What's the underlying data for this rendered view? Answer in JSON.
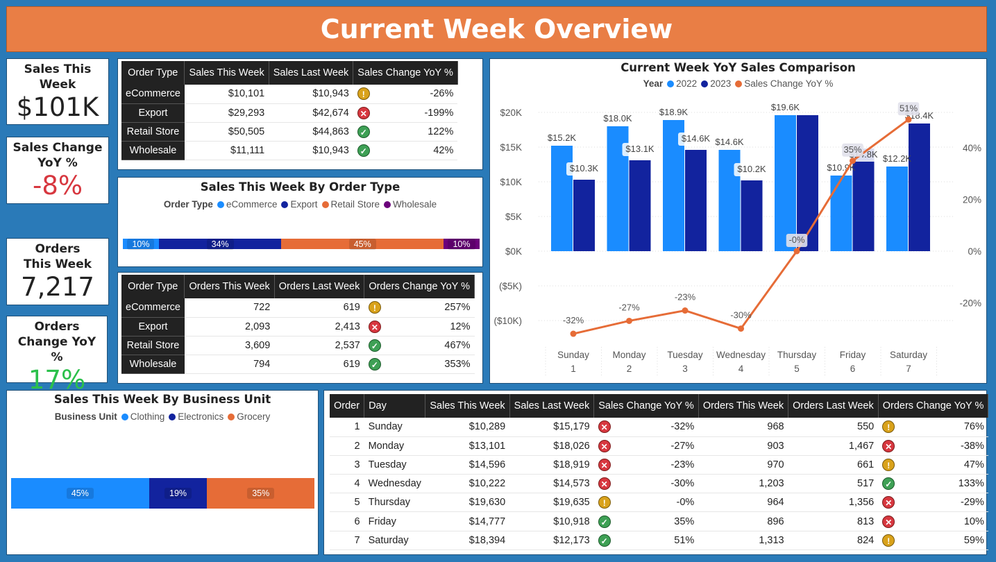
{
  "header": {
    "title": "Current Week Overview"
  },
  "kpis": {
    "sales": {
      "title": "Sales This Week",
      "value": "$101K"
    },
    "sales_change": {
      "title": "Sales Change YoY %",
      "value": "-8%",
      "color": "#d7373f"
    },
    "orders": {
      "title": "Orders This Week",
      "value": "7,217"
    },
    "orders_change": {
      "title": "Orders Change YoY %",
      "value": "17%",
      "color": "#2bc04b"
    }
  },
  "sales_table": {
    "headers": [
      "Order Type",
      "Sales This Week",
      "Sales Last Week",
      "Sales Change YoY %"
    ],
    "rows": [
      {
        "type": "eCommerce",
        "this": "$10,101",
        "last": "$10,943",
        "icon": "warn",
        "change": "-26%"
      },
      {
        "type": "Export",
        "this": "$29,293",
        "last": "$42,674",
        "icon": "bad",
        "change": "-199%"
      },
      {
        "type": "Retail Store",
        "this": "$50,505",
        "last": "$44,863",
        "icon": "good",
        "change": "122%"
      },
      {
        "type": "Wholesale",
        "this": "$11,111",
        "last": "$10,943",
        "icon": "good",
        "change": "42%"
      }
    ]
  },
  "orders_table": {
    "headers": [
      "Order Type",
      "Orders This Week",
      "Orders Last Week",
      "Orders Change YoY %"
    ],
    "rows": [
      {
        "type": "eCommerce",
        "this": "722",
        "last": "619",
        "icon": "warn",
        "change": "257%"
      },
      {
        "type": "Export",
        "this": "2,093",
        "last": "2,413",
        "icon": "bad",
        "change": "12%"
      },
      {
        "type": "Retail Store",
        "this": "3,609",
        "last": "2,537",
        "icon": "good",
        "change": "467%"
      },
      {
        "type": "Wholesale",
        "this": "794",
        "last": "619",
        "icon": "good",
        "change": "353%"
      }
    ]
  },
  "day_table": {
    "headers": [
      "Order",
      "Day",
      "Sales This Week",
      "Sales Last Week",
      "Sales Change YoY %",
      "Orders This Week",
      "Orders Last Week",
      "Orders Change YoY %"
    ],
    "rows": [
      {
        "order": "1",
        "day": "Sunday",
        "st": "$10,289",
        "sl": "$15,179",
        "si": "bad",
        "sc": "-32%",
        "ot": "968",
        "ol": "550",
        "oi": "warn",
        "oc": "76%"
      },
      {
        "order": "2",
        "day": "Monday",
        "st": "$13,101",
        "sl": "$18,026",
        "si": "bad",
        "sc": "-27%",
        "ot": "903",
        "ol": "1,467",
        "oi": "bad",
        "oc": "-38%"
      },
      {
        "order": "3",
        "day": "Tuesday",
        "st": "$14,596",
        "sl": "$18,919",
        "si": "bad",
        "sc": "-23%",
        "ot": "970",
        "ol": "661",
        "oi": "warn",
        "oc": "47%"
      },
      {
        "order": "4",
        "day": "Wednesday",
        "st": "$10,222",
        "sl": "$14,573",
        "si": "bad",
        "sc": "-30%",
        "ot": "1,203",
        "ol": "517",
        "oi": "good",
        "oc": "133%"
      },
      {
        "order": "5",
        "day": "Thursday",
        "st": "$19,630",
        "sl": "$19,635",
        "si": "warn",
        "sc": "-0%",
        "ot": "964",
        "ol": "1,356",
        "oi": "bad",
        "oc": "-29%"
      },
      {
        "order": "6",
        "day": "Friday",
        "st": "$14,777",
        "sl": "$10,918",
        "si": "good",
        "sc": "35%",
        "ot": "896",
        "ol": "813",
        "oi": "bad",
        "oc": "10%"
      },
      {
        "order": "7",
        "day": "Saturday",
        "st": "$18,394",
        "sl": "$12,173",
        "si": "good",
        "sc": "51%",
        "ot": "1,313",
        "ol": "824",
        "oi": "warn",
        "oc": "59%"
      }
    ]
  },
  "icons": {
    "warn": "exclamation-icon",
    "bad": "x-icon",
    "good": "check-icon"
  },
  "colors": {
    "header": "#e97e45",
    "c2022": "#1a8cff",
    "c2023": "#12239e",
    "orange": "#e66c37",
    "purple": "#6b007b"
  },
  "chart_data": [
    {
      "type": "bar",
      "title": "Sales This Week By Order Type",
      "legend_title": "Order Type",
      "orientation": "horizontal-100%-stacked",
      "series": [
        {
          "name": "eCommerce",
          "value": 10,
          "label": "10%",
          "color": "#1a8cff"
        },
        {
          "name": "Export",
          "value": 34,
          "label": "34%",
          "color": "#12239e"
        },
        {
          "name": "Retail Store",
          "value": 45,
          "label": "45%",
          "color": "#e66c37"
        },
        {
          "name": "Wholesale",
          "value": 10,
          "label": "10%",
          "color": "#6b007b"
        }
      ]
    },
    {
      "type": "bar",
      "title": "Sales This Week By Business Unit",
      "legend_title": "Business Unit",
      "orientation": "horizontal-100%-stacked",
      "series": [
        {
          "name": "Clothing",
          "value": 45,
          "label": "45%",
          "color": "#1a8cff"
        },
        {
          "name": "Electronics",
          "value": 19,
          "label": "19%",
          "color": "#12239e"
        },
        {
          "name": "Grocery",
          "value": 35,
          "label": "35%",
          "color": "#e66c37"
        }
      ]
    },
    {
      "type": "bar",
      "title": "Current Week YoY Sales Comparison",
      "legend_title": "Year",
      "categories": [
        [
          "Sunday",
          "1"
        ],
        [
          "Monday",
          "2"
        ],
        [
          "Tuesday",
          "3"
        ],
        [
          "Wednesday",
          "4"
        ],
        [
          "Thursday",
          "5"
        ],
        [
          "Friday",
          "6"
        ],
        [
          "Saturday",
          "7"
        ]
      ],
      "series": [
        {
          "name": "2022",
          "type": "bar",
          "color": "#1a8cff",
          "values": [
            15200,
            18000,
            18900,
            14600,
            19600,
            10900,
            12200
          ],
          "labels": [
            "$15.2K",
            "$18.0K",
            "$18.9K",
            "$14.6K",
            "$19.6K",
            "$10.9K",
            "$12.2K"
          ]
        },
        {
          "name": "2023",
          "type": "bar",
          "color": "#12239e",
          "values": [
            10300,
            13100,
            14600,
            10200,
            19600,
            14800,
            18400
          ],
          "labels": [
            "$10.3K",
            "$13.1K",
            "$14.6K",
            "$10.2K",
            "",
            "$14.8K",
            "$18.4K"
          ]
        },
        {
          "name": "Sales Change YoY %",
          "type": "line",
          "axis": "right",
          "color": "#e66c37",
          "values": [
            -32,
            -27,
            -23,
            -30,
            0,
            35,
            51
          ],
          "labels": [
            "-32%",
            "-27%",
            "-23%",
            "-30%",
            "-0%",
            "35%",
            "51%"
          ]
        }
      ],
      "y_left": {
        "ticks": [
          20000,
          15000,
          10000,
          5000,
          0,
          -5000,
          -10000
        ],
        "tick_labels": [
          "$20K",
          "$15K",
          "$10K",
          "$5K",
          "$0K",
          "($5K)",
          "($10K)"
        ]
      },
      "y_right": {
        "ticks": [
          40,
          20,
          0,
          -20
        ],
        "tick_labels": [
          "40%",
          "20%",
          "0%",
          "-20%"
        ]
      }
    }
  ]
}
